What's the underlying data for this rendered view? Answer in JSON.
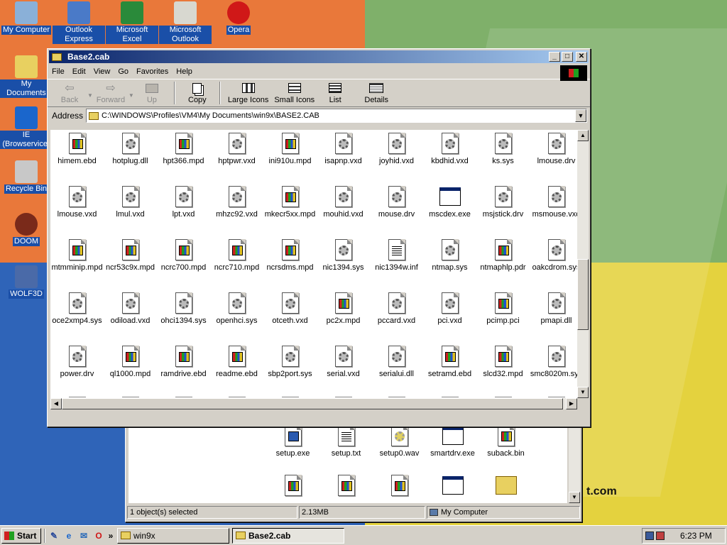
{
  "desktop": {
    "icons": [
      {
        "label": "My Computer",
        "icon": "computer-icon"
      },
      {
        "label": "Outlook Express",
        "icon": "outlook-express-icon"
      },
      {
        "label": "Microsoft Excel",
        "icon": "excel-icon"
      },
      {
        "label": "Microsoft Outlook",
        "icon": "outlook-icon"
      },
      {
        "label": "Opera",
        "icon": "opera-icon"
      },
      {
        "label": "My Documents",
        "icon": "folder-icon"
      },
      {
        "label": "IE (Browservice)",
        "icon": "ie-icon"
      },
      {
        "label": "Recycle Bin",
        "icon": "recycle-bin-icon"
      },
      {
        "label": "DOOM",
        "icon": "doom-icon"
      },
      {
        "label": "WOLF3D",
        "icon": "wolf3d-icon"
      }
    ],
    "watermark": "t.com"
  },
  "back_window": {
    "files": [
      {
        "name": "setup.exe",
        "type": "exe"
      },
      {
        "name": "setup.txt",
        "type": "txt"
      },
      {
        "name": "setup0.wav",
        "type": "wav"
      },
      {
        "name": "smartdrv.exe",
        "type": "app"
      },
      {
        "name": "suback.bin",
        "type": "win"
      },
      {
        "name": "",
        "type": "win"
      },
      {
        "name": "",
        "type": "win"
      },
      {
        "name": "",
        "type": "win"
      },
      {
        "name": "",
        "type": "app"
      },
      {
        "name": "",
        "type": "folder"
      }
    ],
    "status": {
      "selected": "1 object(s) selected",
      "size": "2.13MB",
      "zone": "My Computer"
    }
  },
  "window": {
    "title": "Base2.cab",
    "menu": [
      "File",
      "Edit",
      "View",
      "Go",
      "Favorites",
      "Help"
    ],
    "toolbar": {
      "back": "Back",
      "forward": "Forward",
      "up": "Up",
      "copy": "Copy",
      "large_icons": "Large Icons",
      "small_icons": "Small Icons",
      "list": "List",
      "details": "Details"
    },
    "address_label": "Address",
    "address": "C:\\WINDOWS\\Profiles\\VM4\\My Documents\\win9x\\BASE2.CAB",
    "files": [
      {
        "name": "himem.ebd",
        "type": "win"
      },
      {
        "name": "hotplug.dll",
        "type": "gear"
      },
      {
        "name": "hpt366.mpd",
        "type": "win"
      },
      {
        "name": "hptpwr.vxd",
        "type": "gear"
      },
      {
        "name": "ini910u.mpd",
        "type": "win"
      },
      {
        "name": "isapnp.vxd",
        "type": "gear"
      },
      {
        "name": "joyhid.vxd",
        "type": "gear"
      },
      {
        "name": "kbdhid.vxd",
        "type": "gear"
      },
      {
        "name": "ks.sys",
        "type": "gear"
      },
      {
        "name": "lmouse.drv",
        "type": "gear"
      },
      {
        "name": "lmouse.vxd",
        "type": "gear"
      },
      {
        "name": "lmul.vxd",
        "type": "gear"
      },
      {
        "name": "lpt.vxd",
        "type": "gear"
      },
      {
        "name": "mhzc92.vxd",
        "type": "gear"
      },
      {
        "name": "mkecr5xx.mpd",
        "type": "win"
      },
      {
        "name": "mouhid.vxd",
        "type": "gear"
      },
      {
        "name": "mouse.drv",
        "type": "gear"
      },
      {
        "name": "mscdex.exe",
        "type": "app"
      },
      {
        "name": "msjstick.drv",
        "type": "gear"
      },
      {
        "name": "msmouse.vxd",
        "type": "gear"
      },
      {
        "name": "mtmminip.mpd",
        "type": "win"
      },
      {
        "name": "ncr53c9x.mpd",
        "type": "win"
      },
      {
        "name": "ncrc700.mpd",
        "type": "win"
      },
      {
        "name": "ncrc710.mpd",
        "type": "win"
      },
      {
        "name": "ncrsdms.mpd",
        "type": "win"
      },
      {
        "name": "nic1394.sys",
        "type": "gear"
      },
      {
        "name": "nic1394w.inf",
        "type": "txt"
      },
      {
        "name": "ntmap.sys",
        "type": "gear"
      },
      {
        "name": "ntmaphlp.pdr",
        "type": "win"
      },
      {
        "name": "oakcdrom.sys",
        "type": "gear"
      },
      {
        "name": "oce2xmp4.sys",
        "type": "gear"
      },
      {
        "name": "odiload.vxd",
        "type": "gear"
      },
      {
        "name": "ohci1394.sys",
        "type": "gear"
      },
      {
        "name": "openhci.sys",
        "type": "gear"
      },
      {
        "name": "otceth.vxd",
        "type": "gear"
      },
      {
        "name": "pc2x.mpd",
        "type": "win"
      },
      {
        "name": "pccard.vxd",
        "type": "gear"
      },
      {
        "name": "pci.vxd",
        "type": "gear"
      },
      {
        "name": "pcimp.pci",
        "type": "win"
      },
      {
        "name": "pmapi.dll",
        "type": "gear"
      },
      {
        "name": "power.drv",
        "type": "gear"
      },
      {
        "name": "ql1000.mpd",
        "type": "win"
      },
      {
        "name": "ramdrive.ebd",
        "type": "win"
      },
      {
        "name": "readme.ebd",
        "type": "win"
      },
      {
        "name": "sbp2port.sys",
        "type": "gear"
      },
      {
        "name": "serial.vxd",
        "type": "gear"
      },
      {
        "name": "serialui.dll",
        "type": "gear"
      },
      {
        "name": "setramd.ebd",
        "type": "win"
      },
      {
        "name": "slcd32.mpd",
        "type": "win"
      },
      {
        "name": "smc8020m.sys",
        "type": "gear"
      }
    ]
  },
  "taskbar": {
    "start": "Start",
    "quicklaunch": [
      "show-desktop-icon",
      "ie-icon",
      "outlook-icon",
      "opera-icon"
    ],
    "more": "»",
    "tasks": [
      {
        "label": "win9x",
        "active": false
      },
      {
        "label": "Base2.cab",
        "active": true
      }
    ],
    "clock": "6:23 PM"
  }
}
